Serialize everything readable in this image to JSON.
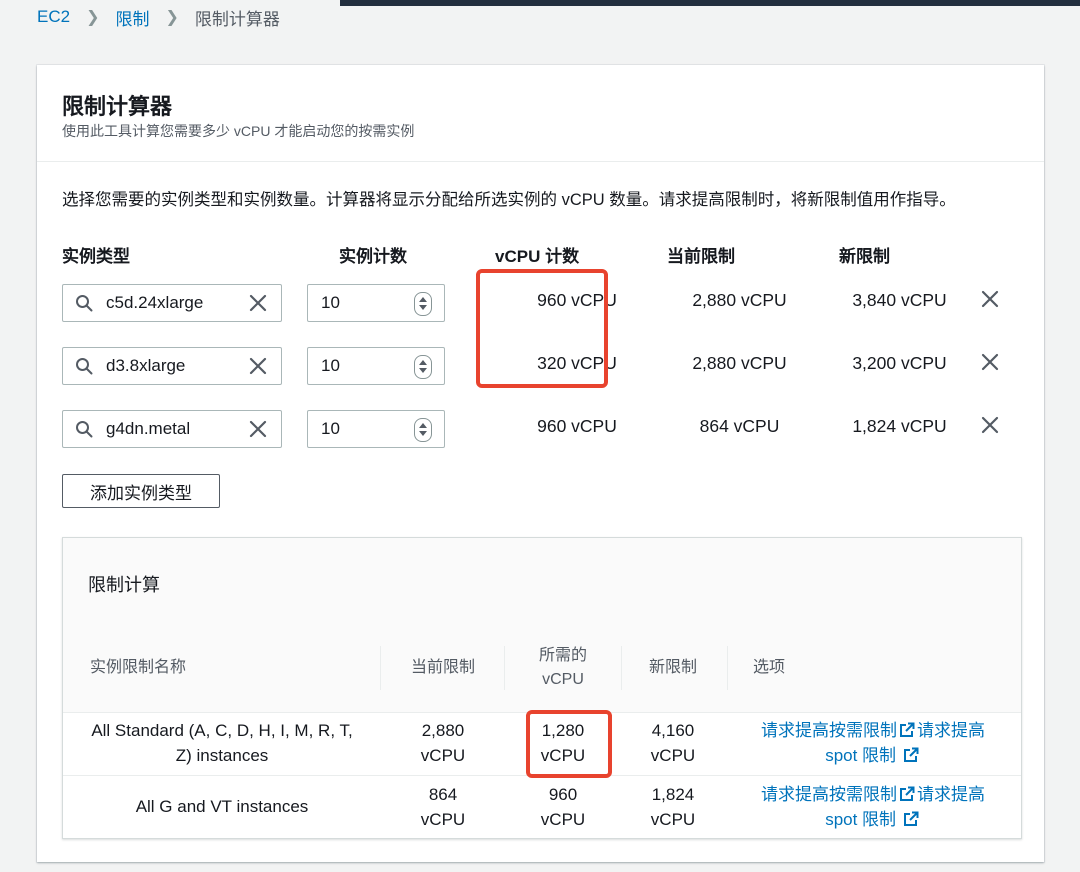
{
  "breadcrumb": {
    "root": "EC2",
    "parent": "限制",
    "current": "限制计算器"
  },
  "card": {
    "title": "限制计算器",
    "description": "使用此工具计算您需要多少 vCPU 才能启动您的按需实例",
    "intro": "选择您需要的实例类型和实例数量。计算器将显示分配给所选实例的 vCPU 数量。请求提高限制时，将新限制值用作指导。"
  },
  "columns": {
    "instance_type": "实例类型",
    "count": "实例计数",
    "vcpu": "vCPU 计数",
    "current_limit": "当前限制",
    "new_limit": "新限制"
  },
  "instances": [
    {
      "type": "c5d.24xlarge",
      "count": "10",
      "vcpu": "960 vCPU",
      "current_limit": "2,880 vCPU",
      "new_limit": "3,840 vCPU"
    },
    {
      "type": "d3.8xlarge",
      "count": "10",
      "vcpu": "320 vCPU",
      "current_limit": "2,880 vCPU",
      "new_limit": "3,200 vCPU"
    },
    {
      "type": "g4dn.metal",
      "count": "10",
      "vcpu": "960 vCPU",
      "current_limit": "864 vCPU",
      "new_limit": "1,824 vCPU"
    }
  ],
  "add_button": "添加实例类型",
  "calc": {
    "title": "限制计算",
    "headers": {
      "name": "实例限制名称",
      "current": "当前限制",
      "required_1": "所需的",
      "required_2": "vCPU",
      "new": "新限制",
      "options": "选项"
    },
    "rows": [
      {
        "name_1": "All Standard (A, C, D, H, I, M, R, T,",
        "name_2": "Z) instances",
        "current_1": "2,880",
        "current_2": "vCPU",
        "required_1": "1,280",
        "required_2": "vCPU",
        "new_1": "4,160",
        "new_2": "vCPU",
        "link_ondemand": "请求提高按需限制",
        "link_spot_1": "请求提高",
        "link_spot_2": "spot 限制"
      },
      {
        "name_1": "All G and VT instances",
        "current_1": "864",
        "current_2": "vCPU",
        "required_1": "960",
        "required_2": "vCPU",
        "new_1": "1,824",
        "new_2": "vCPU",
        "link_ondemand": "请求提高按需限制",
        "link_spot_1": "请求提高",
        "link_spot_2": "spot 限制"
      }
    ]
  },
  "colors": {
    "link": "#0073bb",
    "highlight": "#e8432e",
    "text": "#16191f",
    "secondary_text": "#545b64"
  },
  "icons": [
    "search-icon",
    "clear-icon",
    "stepper-icon",
    "remove-icon",
    "external-link-icon"
  ]
}
